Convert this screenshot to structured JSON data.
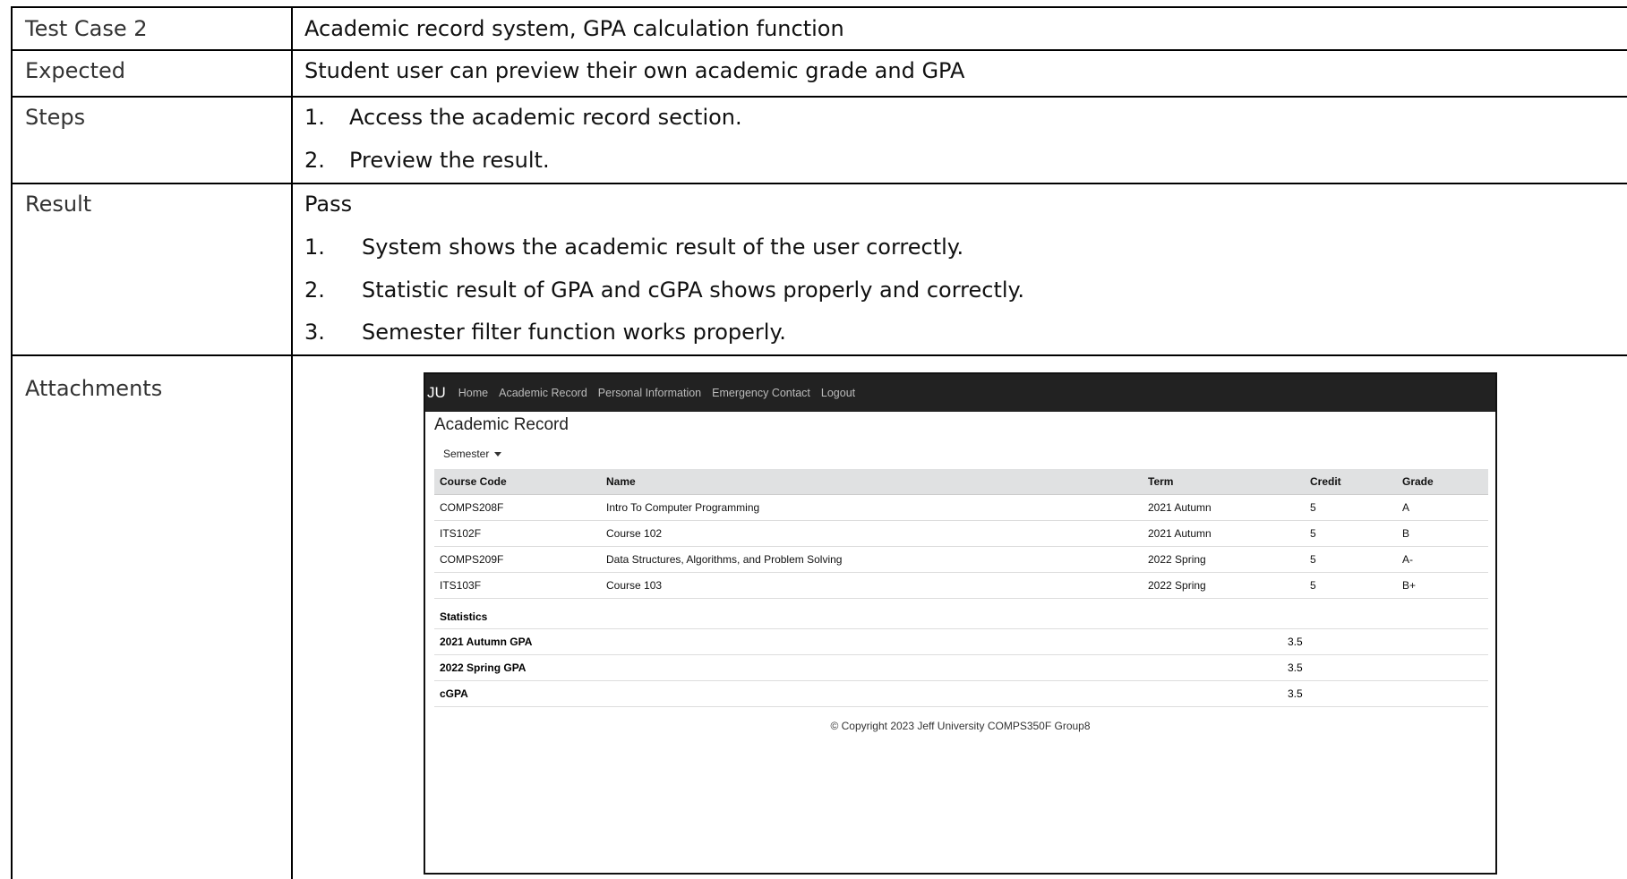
{
  "rows": {
    "test_case": {
      "label": "Test Case 2",
      "value": "Academic record system, GPA calculation function"
    },
    "expected": {
      "label": "Expected",
      "value": "Student user can preview their own academic grade and GPA"
    },
    "steps": {
      "label": "Steps",
      "items": [
        {
          "num": "1.",
          "text": "Access the academic record section."
        },
        {
          "num": "2.",
          "text": "Preview the result."
        }
      ]
    },
    "result": {
      "label": "Result",
      "status": "Pass",
      "items": [
        {
          "num": "1.",
          "text": "System shows the academic result of the user correctly."
        },
        {
          "num": "2.",
          "text": "Statistic result of GPA and cGPA shows properly and correctly."
        },
        {
          "num": "3.",
          "text": "Semester filter function works properly."
        }
      ]
    },
    "attachments": {
      "label": "Attachments"
    }
  },
  "screenshot": {
    "nav": {
      "brand": "JU",
      "links": [
        "Home",
        "Academic Record",
        "Personal Information",
        "Emergency Contact",
        "Logout"
      ]
    },
    "title": "Academic Record",
    "filter_label": "Semester",
    "columns": [
      "Course Code",
      "Name",
      "Term",
      "Credit",
      "Grade"
    ],
    "courses": [
      {
        "code": "COMPS208F",
        "name": "Intro To Computer Programming",
        "term": "2021 Autumn",
        "credit": "5",
        "grade": "A"
      },
      {
        "code": "ITS102F",
        "name": "Course 102",
        "term": "2021 Autumn",
        "credit": "5",
        "grade": "B"
      },
      {
        "code": "COMPS209F",
        "name": "Data Structures, Algorithms, and Problem Solving",
        "term": "2022 Spring",
        "credit": "5",
        "grade": "A-"
      },
      {
        "code": "ITS103F",
        "name": "Course 103",
        "term": "2022 Spring",
        "credit": "5",
        "grade": "B+"
      }
    ],
    "statistics": {
      "title": "Statistics",
      "items": [
        {
          "label": "2021 Autumn GPA",
          "value": "3.5"
        },
        {
          "label": "2022 Spring GPA",
          "value": "3.5"
        },
        {
          "label": "cGPA",
          "value": "3.5"
        }
      ]
    },
    "footer": "© Copyright 2023 Jeff University COMPS350F Group8"
  }
}
